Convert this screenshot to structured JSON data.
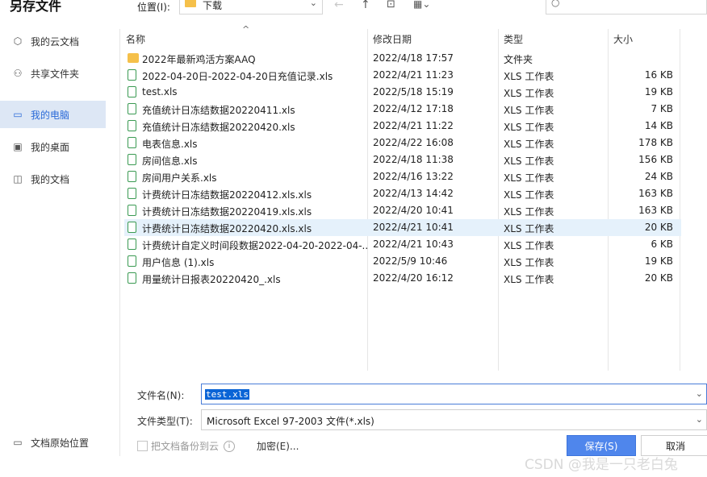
{
  "dialog": {
    "title": "另存文件"
  },
  "location": {
    "label": "位置(I):",
    "value": "下载"
  },
  "sidebar": {
    "items": [
      {
        "label": "我的云文档",
        "icon": "cloud-doc-icon"
      },
      {
        "label": "共享文件夹",
        "icon": "share-icon"
      },
      {
        "label": "我的电脑",
        "icon": "monitor-icon",
        "active": true
      },
      {
        "label": "我的桌面",
        "icon": "desktop-icon"
      },
      {
        "label": "我的文档",
        "icon": "documents-icon"
      }
    ],
    "bottom": {
      "label": "文档原始位置",
      "icon": "folder-icon"
    }
  },
  "columns": {
    "name": "名称",
    "date": "修改日期",
    "type": "类型",
    "size": "大小"
  },
  "files": [
    {
      "name": "2022年最新鸡活方案AAQ",
      "date": "2022/4/18 17:57",
      "type": "文件夹",
      "size": "",
      "kind": "folder"
    },
    {
      "name": "2022-04-20日-2022-04-20日充值记录.xls",
      "date": "2022/4/21 11:23",
      "type": "XLS 工作表",
      "size": "16 KB",
      "kind": "xls"
    },
    {
      "name": "test.xls",
      "date": "2022/5/18 15:19",
      "type": "XLS 工作表",
      "size": "19 KB",
      "kind": "xls"
    },
    {
      "name": "充值统计日冻结数据20220411.xls",
      "date": "2022/4/12 17:18",
      "type": "XLS 工作表",
      "size": "7 KB",
      "kind": "xls"
    },
    {
      "name": "充值统计日冻结数据20220420.xls",
      "date": "2022/4/21 11:22",
      "type": "XLS 工作表",
      "size": "14 KB",
      "kind": "xls"
    },
    {
      "name": "电表信息.xls",
      "date": "2022/4/22 16:08",
      "type": "XLS 工作表",
      "size": "178 KB",
      "kind": "xls"
    },
    {
      "name": "房间信息.xls",
      "date": "2022/4/18 11:38",
      "type": "XLS 工作表",
      "size": "156 KB",
      "kind": "xls"
    },
    {
      "name": "房间用户关系.xls",
      "date": "2022/4/16 13:22",
      "type": "XLS 工作表",
      "size": "24 KB",
      "kind": "xls"
    },
    {
      "name": "计费统计日冻结数据20220412.xls.xls",
      "date": "2022/4/13 14:42",
      "type": "XLS 工作表",
      "size": "163 KB",
      "kind": "xls"
    },
    {
      "name": "计费统计日冻结数据20220419.xls.xls",
      "date": "2022/4/20 10:41",
      "type": "XLS 工作表",
      "size": "163 KB",
      "kind": "xls"
    },
    {
      "name": "计费统计日冻结数据20220420.xls.xls",
      "date": "2022/4/21 10:41",
      "type": "XLS 工作表",
      "size": "20 KB",
      "kind": "xls",
      "selected": true
    },
    {
      "name": "计费统计自定义时间段数据2022-04-20-2022-04-...",
      "date": "2022/4/21 10:43",
      "type": "XLS 工作表",
      "size": "6 KB",
      "kind": "xls"
    },
    {
      "name": "用户信息 (1).xls",
      "date": "2022/5/9 10:46",
      "type": "XLS 工作表",
      "size": "19 KB",
      "kind": "xls"
    },
    {
      "name": "用量统计日报表20220420_.xls",
      "date": "2022/4/20 16:12",
      "type": "XLS 工作表",
      "size": "20 KB",
      "kind": "xls"
    }
  ],
  "form": {
    "filename_label": "文件名(N):",
    "filename_value": "test.xls",
    "filetype_label": "文件类型(T):",
    "filetype_value": "Microsoft Excel 97-2003 文件(*.xls)"
  },
  "options": {
    "backup_label": "把文档备份到云",
    "encrypt_label": "加密(E)..."
  },
  "buttons": {
    "save": "保存(S)",
    "cancel": "取消"
  },
  "watermark": "CSDN @我是一只老白兔",
  "colors": {
    "accent": "#4f86ec",
    "selected_row": "#e5f1fb",
    "sidebar_active": "#dde7f5",
    "xls_icon": "#3a9a52",
    "folder": "#f5c04a"
  }
}
